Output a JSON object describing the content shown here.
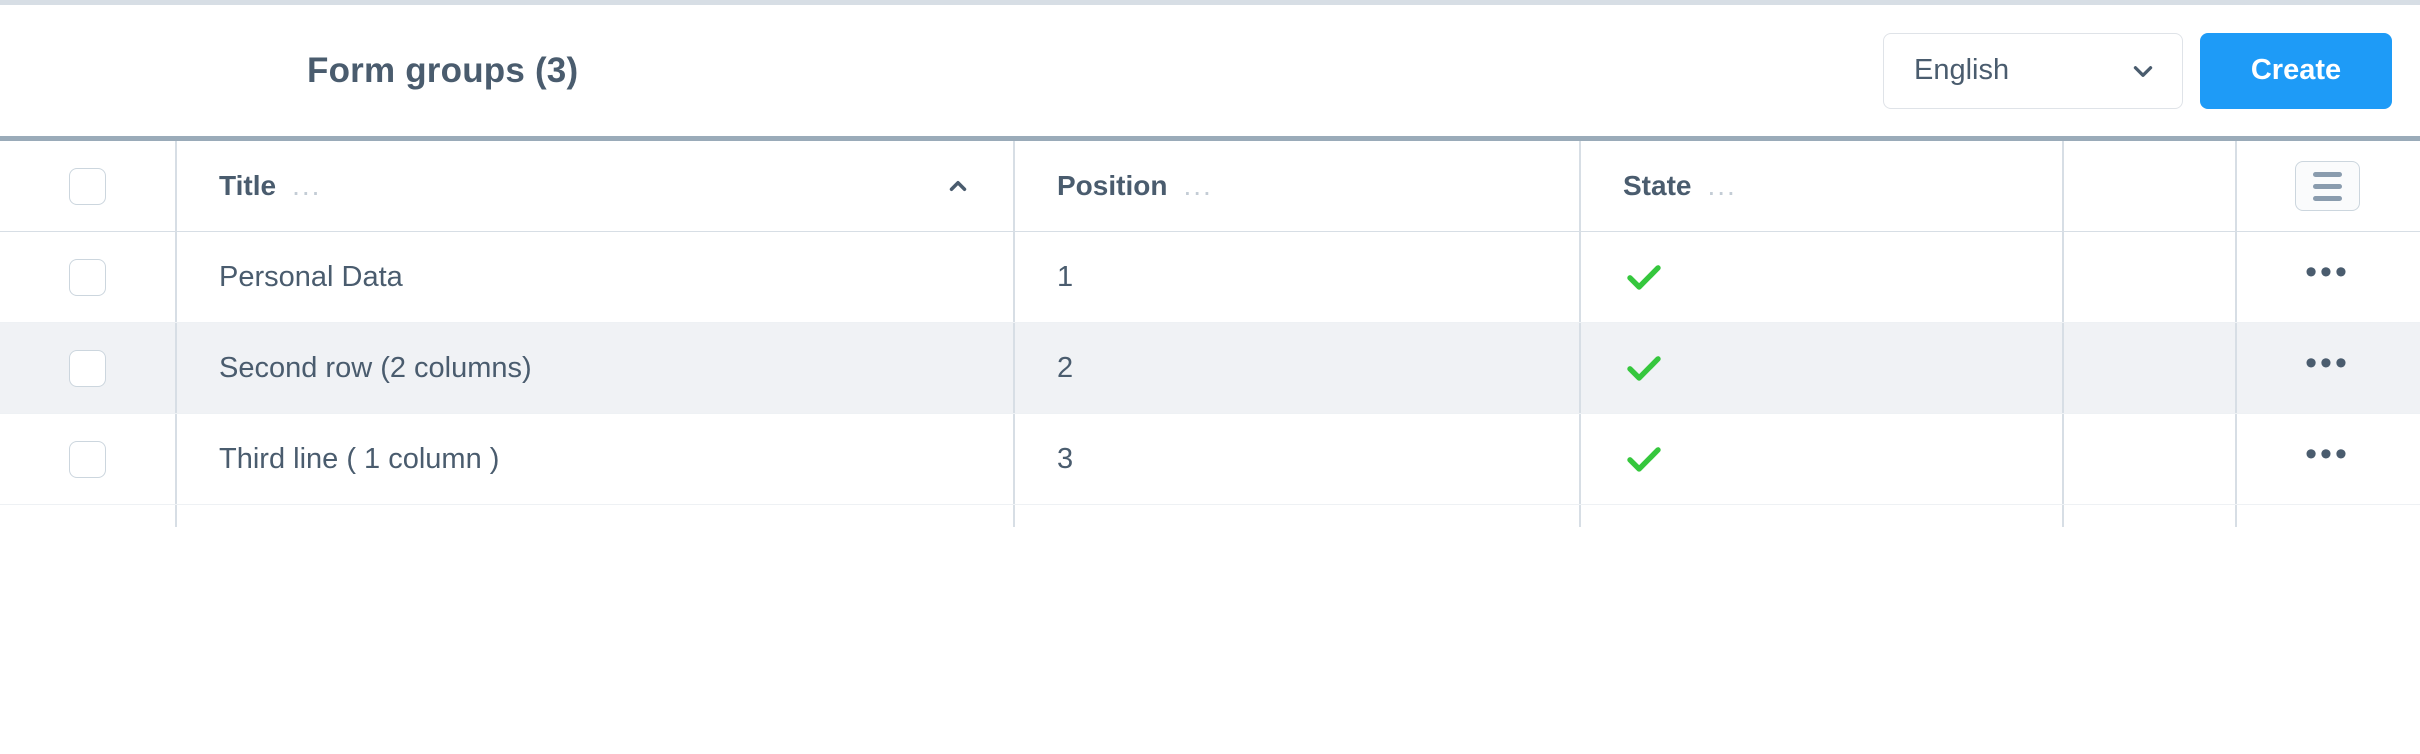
{
  "header": {
    "title": "Form groups (3)",
    "language_select": {
      "value": "English",
      "icon": "chevron-down-icon"
    },
    "create_label": "Create"
  },
  "table": {
    "columns": [
      {
        "key": "select",
        "label": "",
        "menu": ""
      },
      {
        "key": "title",
        "label": "Title",
        "menu": "...",
        "sort": "asc"
      },
      {
        "key": "position",
        "label": "Position",
        "menu": "..."
      },
      {
        "key": "state",
        "label": "State",
        "menu": "..."
      },
      {
        "key": "blank",
        "label": "",
        "menu": ""
      },
      {
        "key": "actions",
        "label": "",
        "menu": ""
      }
    ],
    "header_menu_icon": "hamburger-icon",
    "row_menu_glyph": "•••",
    "rows": [
      {
        "title": "Personal Data",
        "position": "1",
        "state": "check",
        "selected": false,
        "highlighted": false
      },
      {
        "title": "Second row (2 columns)",
        "position": "2",
        "state": "check",
        "selected": false,
        "highlighted": true
      },
      {
        "title": "Third line ( 1 column )",
        "position": "3",
        "state": "check",
        "selected": false,
        "highlighted": false
      }
    ]
  },
  "colors": {
    "accent": "#1e9bf7",
    "text": "#4a5c6e",
    "check_green": "#35c73d",
    "rule": "#d7dee5",
    "header_rule": "#9aabb9",
    "zebra": "#f0f2f5"
  }
}
